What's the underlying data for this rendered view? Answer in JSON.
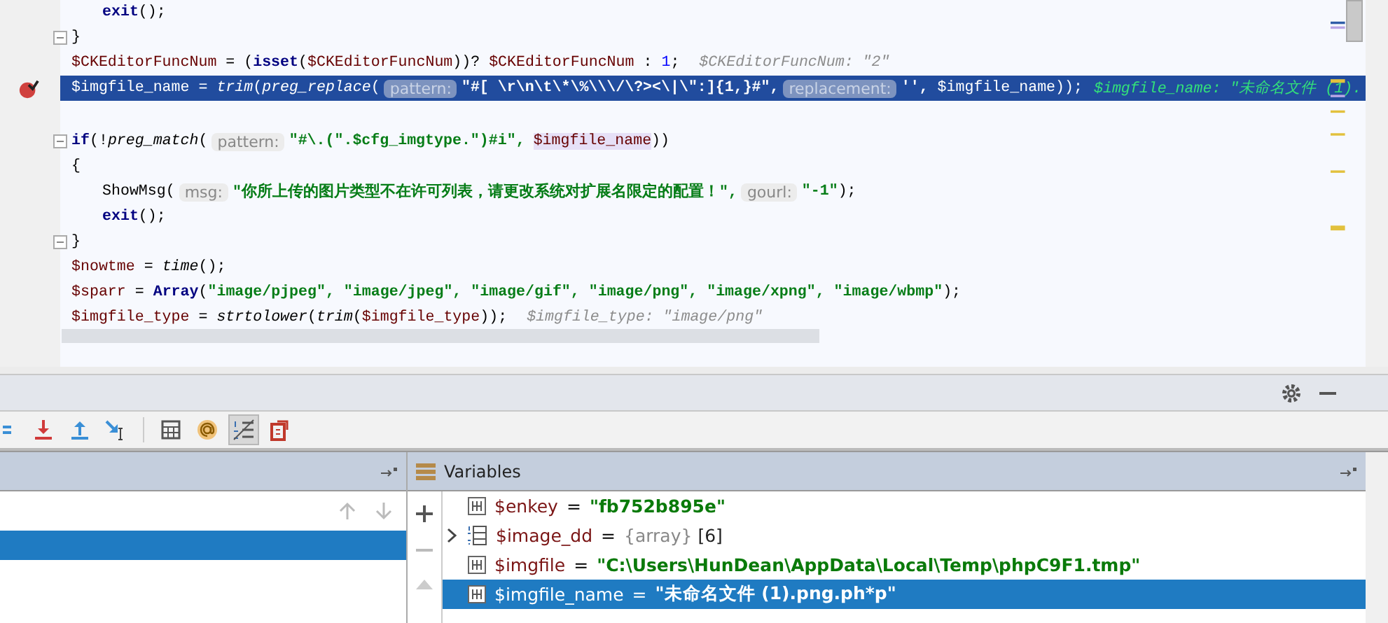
{
  "editor": {
    "lines": [
      {
        "indented": true,
        "tokens": [
          {
            "kind": "kw",
            "text": "exit"
          },
          {
            "kind": "plain",
            "text": "();"
          }
        ]
      },
      {
        "fold": true,
        "tokens": [
          {
            "kind": "plain",
            "text": "}"
          }
        ]
      },
      {
        "tokens": [
          {
            "kind": "var",
            "text": "$CKEditorFuncNum"
          },
          {
            "kind": "plain",
            "text": " = ("
          },
          {
            "kind": "kw",
            "text": "isset"
          },
          {
            "kind": "plain",
            "text": "("
          },
          {
            "kind": "var",
            "text": "$CKEditorFuncNum"
          },
          {
            "kind": "plain",
            "text": "))? "
          },
          {
            "kind": "var",
            "text": "$CKEditorFuncNum"
          },
          {
            "kind": "plain",
            "text": " : "
          },
          {
            "kind": "num",
            "text": "1"
          },
          {
            "kind": "plain",
            "text": ";"
          },
          {
            "kind": "debug",
            "text": "$CKEditorFuncNum: \"2\""
          }
        ]
      },
      {
        "breakpoint": true,
        "current": true,
        "tokens": [
          {
            "kind": "var",
            "text": "$imgfile_name"
          },
          {
            "kind": "plain",
            "text": " = "
          },
          {
            "kind": "fn",
            "text": "trim"
          },
          {
            "kind": "plain",
            "text": "("
          },
          {
            "kind": "fn",
            "text": "preg_replace"
          },
          {
            "kind": "plain",
            "text": "("
          },
          {
            "kind": "hint",
            "text": "pattern:"
          },
          {
            "kind": "str",
            "text": "\"#[ \\r\\n\\t\\*\\%\\\\\\/\\?><\\|\\\":]{1,}#\","
          },
          {
            "kind": "hint",
            "text": "replacement:"
          },
          {
            "kind": "str",
            "text": "'', "
          },
          {
            "kind": "var",
            "text": "$imgfile_name"
          },
          {
            "kind": "plain",
            "text": "));"
          },
          {
            "kind": "debug",
            "text": "$imgfile_name: \"未命名文件 (1)."
          }
        ]
      },
      {
        "fold": true,
        "spaced": true,
        "tokens": [
          {
            "kind": "kw",
            "text": "if"
          },
          {
            "kind": "plain",
            "text": "(!"
          },
          {
            "kind": "fn",
            "text": "preg_match"
          },
          {
            "kind": "plain",
            "text": "("
          },
          {
            "kind": "hint",
            "text": "pattern:"
          },
          {
            "kind": "str",
            "text": "\"#\\.(\".$cfg_imgtype.\")#i\","
          },
          {
            "kind": "varhl",
            "text": "$imgfile_name"
          },
          {
            "kind": "plain",
            "text": "))"
          }
        ]
      },
      {
        "tokens": [
          {
            "kind": "plain",
            "text": "{"
          }
        ]
      },
      {
        "indented": true,
        "tokens": [
          {
            "kind": "plain",
            "text": "ShowMsg("
          },
          {
            "kind": "hint",
            "text": "msg:"
          },
          {
            "kind": "str",
            "text": "\"你所上传的图片类型不在许可列表，请更改系统对扩展名限定的配置！\","
          },
          {
            "kind": "hint",
            "text": "gourl:"
          },
          {
            "kind": "str",
            "text": "\"-1\""
          },
          {
            "kind": "plain",
            "text": ");"
          }
        ]
      },
      {
        "indented": true,
        "tokens": [
          {
            "kind": "kw",
            "text": "exit"
          },
          {
            "kind": "plain",
            "text": "();"
          }
        ]
      },
      {
        "fold": true,
        "tokens": [
          {
            "kind": "plain",
            "text": "}"
          }
        ]
      },
      {
        "tokens": [
          {
            "kind": "var",
            "text": "$nowtme"
          },
          {
            "kind": "plain",
            "text": " = "
          },
          {
            "kind": "fn",
            "text": "time"
          },
          {
            "kind": "plain",
            "text": "();"
          }
        ]
      },
      {
        "tokens": [
          {
            "kind": "var",
            "text": "$sparr"
          },
          {
            "kind": "plain",
            "text": " = "
          },
          {
            "kind": "kw",
            "text": "Array"
          },
          {
            "kind": "plain",
            "text": "("
          },
          {
            "kind": "str",
            "text": "\"image/pjpeg\", \"image/jpeg\", \"image/gif\", \"image/png\", \"image/xpng\", \"image/wbmp\""
          },
          {
            "kind": "plain",
            "text": ");"
          }
        ]
      },
      {
        "tokens": [
          {
            "kind": "var",
            "text": "$imgfile_type"
          },
          {
            "kind": "plain",
            "text": " = "
          },
          {
            "kind": "fn",
            "text": "strtolower"
          },
          {
            "kind": "plain",
            "text": "("
          },
          {
            "kind": "fn",
            "text": "trim"
          },
          {
            "kind": "plain",
            "text": "("
          },
          {
            "kind": "var",
            "text": "$imgfile_type"
          },
          {
            "kind": "plain",
            "text": "));"
          },
          {
            "kind": "debug",
            "text": "$imgfile_type: \"image/png\""
          }
        ]
      }
    ]
  },
  "toolbar": [
    {
      "kind": "step-over",
      "pressed": false
    },
    {
      "kind": "step-into",
      "pressed": false
    },
    {
      "kind": "step-out",
      "pressed": false
    },
    {
      "kind": "run-to-cursor",
      "pressed": false
    },
    {
      "kind": "evaluate",
      "pressed": false
    },
    {
      "kind": "watch",
      "pressed": false
    },
    {
      "kind": "toggle-list",
      "pressed": true
    },
    {
      "kind": "restore",
      "pressed": false
    }
  ],
  "frames": {
    "rows": [
      {
        "selected": true
      }
    ]
  },
  "variables": {
    "title": "Variables",
    "rows": [
      {
        "kind": "string",
        "name": "$enkey",
        "equals": "=",
        "value": "\"fb752b895e\"",
        "selected": false
      },
      {
        "kind": "array",
        "name": "$image_dd",
        "equals": "=",
        "type": "{array}",
        "value": "[6]",
        "selected": false
      },
      {
        "kind": "string",
        "name": "$imgfile",
        "equals": "=",
        "value": "\"C:\\Users\\HunDean\\AppData\\Local\\Temp\\phpC9F1.tmp\"",
        "selected": false
      },
      {
        "kind": "string",
        "name": "$imgfile_name",
        "equals": "=",
        "value": "\"未命名文件 (1).png.ph*p\"",
        "selected": true
      }
    ]
  }
}
